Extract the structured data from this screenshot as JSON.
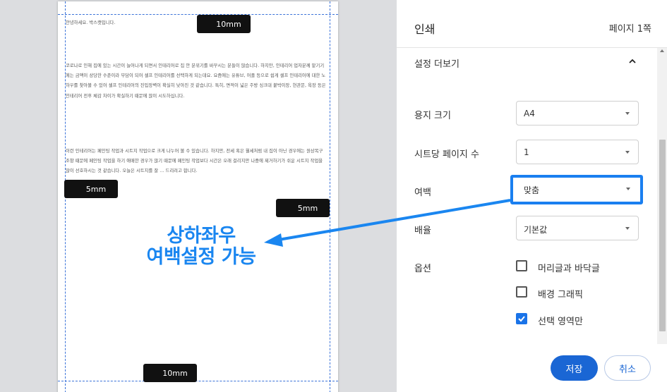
{
  "preview": {
    "greeting": "안녕하세요. 박스캣입니다.",
    "paragraph1": "코로나로 인해 집에 있는 시간이 늘어나게 되면서 인테리어로 집 안 분위기를 바꾸시는 분들이 많습니다. 하지만, 인테리어 업자분께 맡기기에는 금액이 상당한 수준이라 부담이 되어 셀프 인테리어를 선택하게 되는데요. 요즘에는 유튜브, 어플 등으로 쉽게 셀프 인테리어에 대한 노하우를 찾아볼 수 있어 셀프 인테리어의 진입장벽이 확실히 낮아진 것 같습니다. 특히, 면적이 넓은 주방 싱크대 붙박이장, 현관문, 욕장 등은 인테리어 전후 체감 차이가 확실하기 때문에 많이 시도하십니다.",
    "paragraph2": "이런 인테리어는 페인팅 작업과 시트지 작업으로 크게 나누어 볼 수 있습니다. 하지만, 전세 혹은 월세처럼 내 집이 아닌 경우에는 원상복구 조항 때문에 페인팅 작업을 하기 애매한 경우가 많기 때문에 페인팅 작업보다 시간은 오래 걸리지만 나중에 제거하기가 쉬운 시트지 작업을 많이 선호하시는 것 같습니다. 오늘은 시트지를 잘 ... 드리려고 합니다.",
    "margin_tags": {
      "top": "10mm",
      "left": "5mm",
      "right": "5mm",
      "bottom": "10mm"
    },
    "annotation_line1": "상하좌우",
    "annotation_line2": "여백설정 가능"
  },
  "panel": {
    "title": "인쇄",
    "pages": "페이지 1쪽",
    "more_settings": "설정 더보기",
    "paper_size": {
      "label": "용지 크기",
      "value": "A4"
    },
    "pages_per_sheet": {
      "label": "시트당 페이지 수",
      "value": "1"
    },
    "margins": {
      "label": "여백",
      "value": "맞춤"
    },
    "scale": {
      "label": "배율",
      "value": "기본값"
    },
    "options": {
      "label": "옵션",
      "items": [
        {
          "label": "머리글과 바닥글",
          "checked": false
        },
        {
          "label": "배경 그래픽",
          "checked": false
        },
        {
          "label": "선택 영역만",
          "checked": true
        }
      ]
    },
    "save_label": "저장",
    "cancel_label": "취소"
  },
  "colors": {
    "accent": "#1a66d4",
    "annotation": "#1a86f0",
    "highlight_border": "#1a7ff0",
    "guide": "#3b73d9"
  },
  "icons": [
    "chevron-up-icon",
    "dropdown-arrow-icon",
    "checkmark-icon",
    "arrow-annotation-icon"
  ]
}
